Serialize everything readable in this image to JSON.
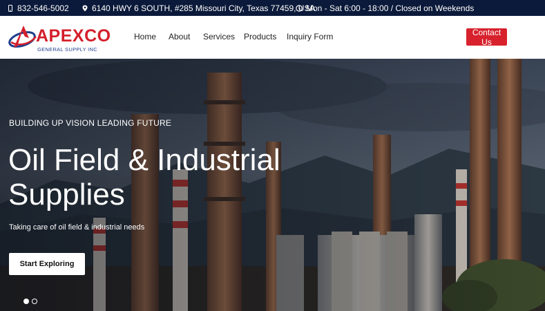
{
  "topbar": {
    "phone": "832-546-5002",
    "address": "6140 HWY 6 SOUTH, #285 Missouri City, Texas 77459, USA",
    "hours": "Mon - Sat 6:00 - 18:00 / Closed on Weekends",
    "icons": {
      "phone": "phone-icon",
      "address": "map-pin-icon",
      "hours": "clock-icon"
    }
  },
  "header": {
    "logo": {
      "name": "APEXCO",
      "subtitle": "GENERAL SUPPLY INC",
      "icon": "apexco-swoosh-logo"
    },
    "nav": [
      "Home",
      "About",
      "Services",
      "Products",
      "Inquiry Form"
    ],
    "contact_label": "Contact Us"
  },
  "hero": {
    "kicker": "BUILDING UP VISION LEADING FUTURE",
    "headline": "Oil Field & Industrial Supplies",
    "tagline": "Taking care of oil field & industrial needs",
    "cta_label": "Start Exploring",
    "slides": 2,
    "active_slide": 1
  },
  "colors": {
    "topbar": "#0b1a3a",
    "brand_red": "#d41f2b",
    "brand_blue": "#1e3f8c",
    "button_red": "#d7222d"
  }
}
